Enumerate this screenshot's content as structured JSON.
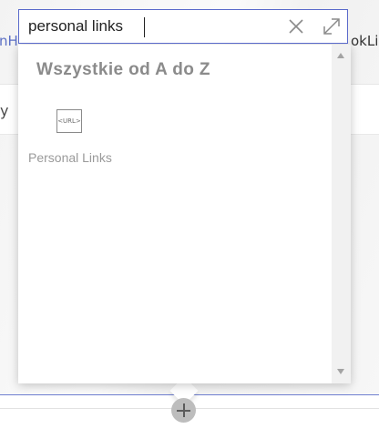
{
  "background": {
    "left_link_fragment": "nH",
    "right_link_fragment": "okLi",
    "band_text_fragment": "y"
  },
  "search": {
    "value": "personal links",
    "clear_icon": "close-icon",
    "expand_icon": "expand-icon"
  },
  "picker": {
    "section_heading": "Wszystkie od A do Z",
    "webparts": [
      {
        "label": "Personal Links",
        "icon": "url-icon",
        "icon_text": "<URL>"
      }
    ]
  },
  "add_section_icon": "plus-icon",
  "colors": {
    "accent": "#5a6acb",
    "heading": "#8b8b8b"
  }
}
